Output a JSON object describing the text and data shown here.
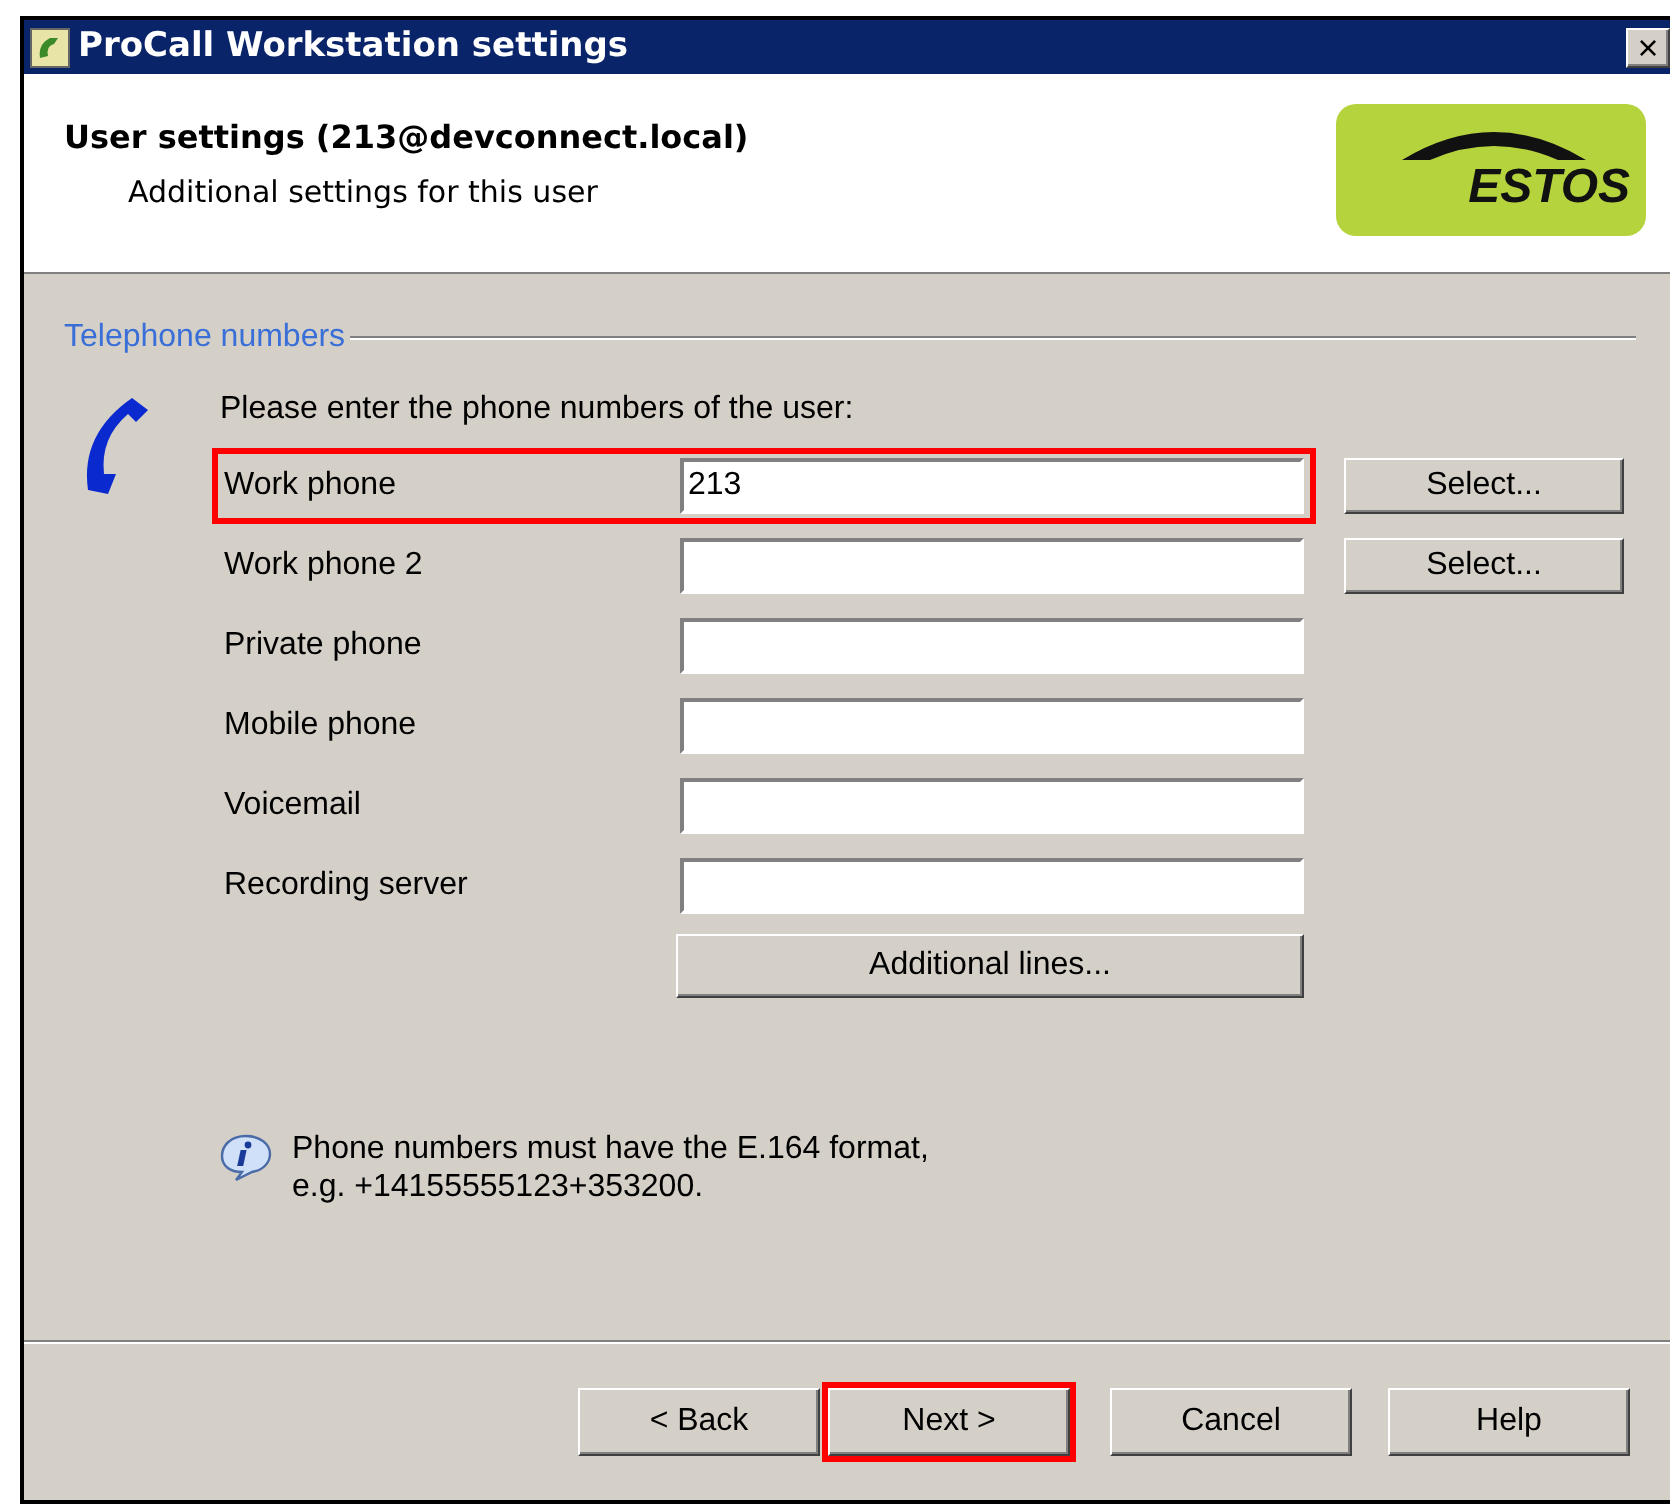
{
  "window": {
    "title": "ProCall Workstation settings",
    "close": "×"
  },
  "header": {
    "title": "User settings (213@devconnect.local)",
    "subtitle": "Additional settings for this user",
    "logo": "ESTOS"
  },
  "group": {
    "label": "Telephone numbers",
    "instruction": "Please enter the phone numbers of the user:",
    "fields": [
      {
        "label": "Work phone",
        "value": "213",
        "highlighted": true,
        "select": "Select..."
      },
      {
        "label": "Work phone 2",
        "highlighted": false,
        "select": "Select..."
      },
      {
        "label": "Private phone",
        "highlighted": false
      },
      {
        "label": "Mobile phone",
        "highlighted": false
      },
      {
        "label": "Voicemail",
        "highlighted": false
      },
      {
        "label": "Recording server",
        "highlighted": false
      }
    ],
    "additional_button": "Additional lines...",
    "info": [
      "Phone numbers must have the E.164 format,",
      "e.g. +14155555123+353200."
    ]
  },
  "buttons": [
    {
      "label": "< Back",
      "highlighted": false
    },
    {
      "label": "Next >",
      "highlighted": true
    },
    {
      "label": "Cancel",
      "highlighted": false
    },
    {
      "label": "Help",
      "highlighted": false
    }
  ]
}
